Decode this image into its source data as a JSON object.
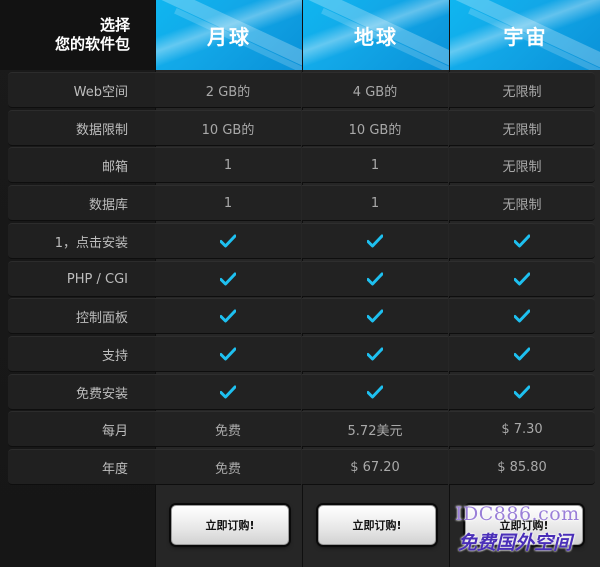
{
  "header": {
    "left_line1": "选择",
    "left_line2": "您的软件包",
    "plans": [
      "月球",
      "地球",
      "宇宙"
    ]
  },
  "rows": [
    {
      "label": "Web空间",
      "values": [
        "2 GB的",
        "4 GB的",
        "无限制"
      ]
    },
    {
      "label": "数据限制",
      "values": [
        "10 GB的",
        "10 GB的",
        "无限制"
      ]
    },
    {
      "label": "邮箱",
      "values": [
        "1",
        "1",
        "无限制"
      ]
    },
    {
      "label": "数据库",
      "values": [
        "1",
        "1",
        "无限制"
      ]
    },
    {
      "label": "1，点击安装",
      "values": [
        "check",
        "check",
        "check"
      ]
    },
    {
      "label": "PHP / CGI",
      "values": [
        "check",
        "check",
        "check"
      ]
    },
    {
      "label": "控制面板",
      "values": [
        "check",
        "check",
        "check"
      ]
    },
    {
      "label": "支持",
      "values": [
        "check",
        "check",
        "check"
      ]
    },
    {
      "label": "免费安装",
      "values": [
        "check",
        "check",
        "check"
      ]
    },
    {
      "label": "每月",
      "values": [
        "免费",
        "5.72美元",
        "$ 7.30"
      ]
    },
    {
      "label": "年度",
      "values": [
        "免费",
        "$ 67.20",
        "$ 85.80"
      ]
    }
  ],
  "buttons": {
    "order_label": "立即订购!"
  },
  "watermark": {
    "line1": "IDC886.com",
    "line2": "免费国外空间"
  },
  "colors": {
    "accent": "#12a8e8",
    "check": "#1ec0f0"
  }
}
